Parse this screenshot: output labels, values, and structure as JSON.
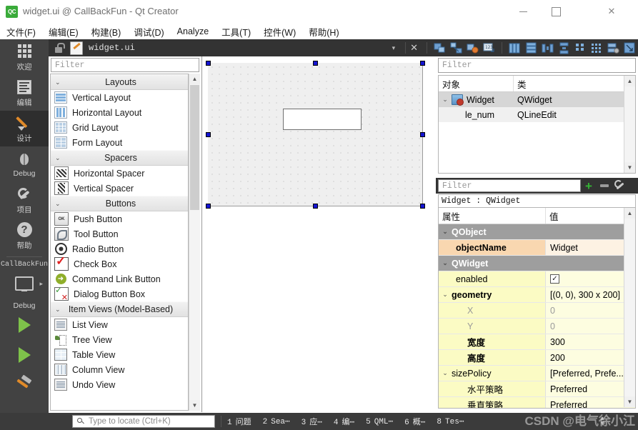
{
  "window": {
    "title": "widget.ui @ CallBackFun - Qt Creator",
    "logo": "QC",
    "minimize": "minimize-button",
    "maximize": "maximize-button",
    "close": "✕"
  },
  "menubar": {
    "items": [
      {
        "label": "文件(F)"
      },
      {
        "label": "编辑(E)"
      },
      {
        "label": "构建(B)"
      },
      {
        "label": "调试(D)"
      },
      {
        "label": "Analyze"
      },
      {
        "label": "工具(T)"
      },
      {
        "label": "控件(W)"
      },
      {
        "label": "帮助(H)"
      }
    ]
  },
  "modebar": {
    "modes": [
      {
        "label": "欢迎",
        "icon": "grid-icon",
        "selected": false
      },
      {
        "label": "编辑",
        "icon": "document-icon",
        "selected": false
      },
      {
        "label": "设计",
        "icon": "pencil-icon",
        "selected": true
      },
      {
        "label": "Debug",
        "icon": "bug-icon",
        "selected": false
      },
      {
        "label": "项目",
        "icon": "wrench-icon",
        "selected": false
      },
      {
        "label": "帮助",
        "icon": "question-icon",
        "selected": false
      }
    ],
    "kit_name": "CallBackFun",
    "kit_mode": "Debug",
    "run_label": "run-button",
    "debug_label": "debug-button",
    "build_label": "build-button"
  },
  "designer_toolbar": {
    "filename": "widget.ui",
    "dropdown": "▾",
    "close": "✕",
    "tools": [
      {
        "name": "edit-widgets-icon"
      },
      {
        "name": "edit-signals-slots-icon"
      },
      {
        "name": "edit-buddies-icon"
      },
      {
        "name": "edit-tab-order-icon"
      },
      {
        "name": "layout-horizontally-icon"
      },
      {
        "name": "layout-vertically-icon"
      },
      {
        "name": "layout-splitter-horizontal-icon"
      },
      {
        "name": "layout-splitter-vertical-icon"
      },
      {
        "name": "layout-form-icon"
      },
      {
        "name": "layout-grid-icon"
      },
      {
        "name": "break-layout-icon"
      },
      {
        "name": "adjust-size-icon"
      }
    ]
  },
  "widgetbox": {
    "filter_placeholder": "Filter",
    "categories": [
      {
        "title": "Layouts",
        "items": [
          {
            "label": "Vertical Layout",
            "icon": "vertical-layout-icon"
          },
          {
            "label": "Horizontal Layout",
            "icon": "horizontal-layout-icon"
          },
          {
            "label": "Grid Layout",
            "icon": "grid-layout-icon"
          },
          {
            "label": "Form Layout",
            "icon": "form-layout-icon"
          }
        ]
      },
      {
        "title": "Spacers",
        "items": [
          {
            "label": "Horizontal Spacer",
            "icon": "horizontal-spacer-icon"
          },
          {
            "label": "Vertical Spacer",
            "icon": "vertical-spacer-icon"
          }
        ]
      },
      {
        "title": "Buttons",
        "items": [
          {
            "label": "Push Button",
            "icon": "push-button-icon"
          },
          {
            "label": "Tool Button",
            "icon": "tool-button-icon"
          },
          {
            "label": "Radio Button",
            "icon": "radio-button-icon"
          },
          {
            "label": "Check Box",
            "icon": "check-box-icon"
          },
          {
            "label": "Command Link Button",
            "icon": "command-link-icon"
          },
          {
            "label": "Dialog Button Box",
            "icon": "dialog-button-box-icon"
          }
        ]
      },
      {
        "title": "Item Views (Model-Based)",
        "items": [
          {
            "label": "List View",
            "icon": "list-view-icon"
          },
          {
            "label": "Tree View",
            "icon": "tree-view-icon"
          },
          {
            "label": "Table View",
            "icon": "table-view-icon"
          },
          {
            "label": "Column View",
            "icon": "column-view-icon"
          },
          {
            "label": "Undo View",
            "icon": "undo-view-icon"
          }
        ]
      }
    ]
  },
  "canvas": {
    "form_name": "Widget",
    "form_width": 300,
    "form_height": 200,
    "child_widget": "le_num",
    "handle_color": "#1414d2"
  },
  "object_inspector": {
    "filter_placeholder": "Filter",
    "columns": [
      "对象",
      "类"
    ],
    "rows": [
      {
        "object": "Widget",
        "class": "QWidget",
        "selected": true,
        "icon": "widget-icon"
      },
      {
        "object": "le_num",
        "class": "QLineEdit",
        "selected": false,
        "icon": ""
      }
    ]
  },
  "property_editor": {
    "filter_placeholder": "Filter",
    "add_button": "+",
    "remove_button": "−",
    "configure_button": "wrench",
    "header": "Widget : QWidget",
    "columns": [
      "属性",
      "值"
    ],
    "rows": [
      {
        "name": "QObject",
        "value": "",
        "type": "group",
        "indent": 0,
        "expandable": true
      },
      {
        "name": "objectName",
        "value": "Widget",
        "type": "orange",
        "indent": 1,
        "bold": true
      },
      {
        "name": "QWidget",
        "value": "",
        "type": "group",
        "indent": 0,
        "expandable": true
      },
      {
        "name": "enabled",
        "value": "✓",
        "type": "yellow",
        "indent": 1,
        "widget": "checkbox"
      },
      {
        "name": "geometry",
        "value": "[(0, 0), 300 x 200]",
        "type": "yellow",
        "indent": 0,
        "expandable": true,
        "bold": true
      },
      {
        "name": "X",
        "value": "0",
        "type": "yellow",
        "indent": 2,
        "gray": true
      },
      {
        "name": "Y",
        "value": "0",
        "type": "yellow",
        "indent": 2,
        "gray": true
      },
      {
        "name": "宽度",
        "value": "300",
        "type": "yellow",
        "indent": 2,
        "bold": true
      },
      {
        "name": "高度",
        "value": "200",
        "type": "yellow",
        "indent": 2,
        "bold": true
      },
      {
        "name": "sizePolicy",
        "value": "[Preferred, Prefe...",
        "type": "yellow",
        "indent": 0,
        "expandable": true
      },
      {
        "name": "水平策略",
        "value": "Preferred",
        "type": "yellow",
        "indent": 2
      },
      {
        "name": "垂直策略",
        "value": "Preferred",
        "type": "yellow",
        "indent": 2
      }
    ]
  },
  "statusbar": {
    "locate_placeholder": "Type to locate (Ctrl+K)",
    "panes": [
      {
        "num": "1",
        "label": "问题"
      },
      {
        "num": "2",
        "label": "Sea⋯"
      },
      {
        "num": "3",
        "label": "应⋯"
      },
      {
        "num": "4",
        "label": "编⋯"
      },
      {
        "num": "5",
        "label": "QML⋯"
      },
      {
        "num": "6",
        "label": "概⋯"
      },
      {
        "num": "8",
        "label": "Tes⋯"
      }
    ]
  },
  "watermark": "CSDN @电气徐小江"
}
